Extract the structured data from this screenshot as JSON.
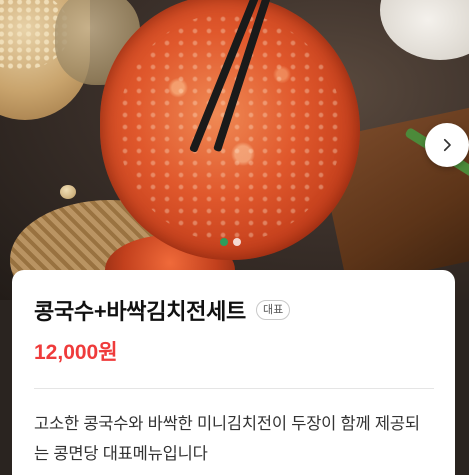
{
  "product": {
    "title": "콩국수+바싹김치전세트",
    "badge": "대표",
    "price": "12,000원",
    "description": "고소한 콩국수와 바싹한 미니김치전이 두장이 함께 제공되는 콩면당 대표메뉴입니다"
  },
  "carousel": {
    "next_icon": "chevron-right-icon",
    "slide_count": 2,
    "active_slide": 1
  },
  "colors": {
    "price": "#ef3b3b",
    "active_dot": "#2e9c5b",
    "inactive_dot": "#ffffff"
  }
}
